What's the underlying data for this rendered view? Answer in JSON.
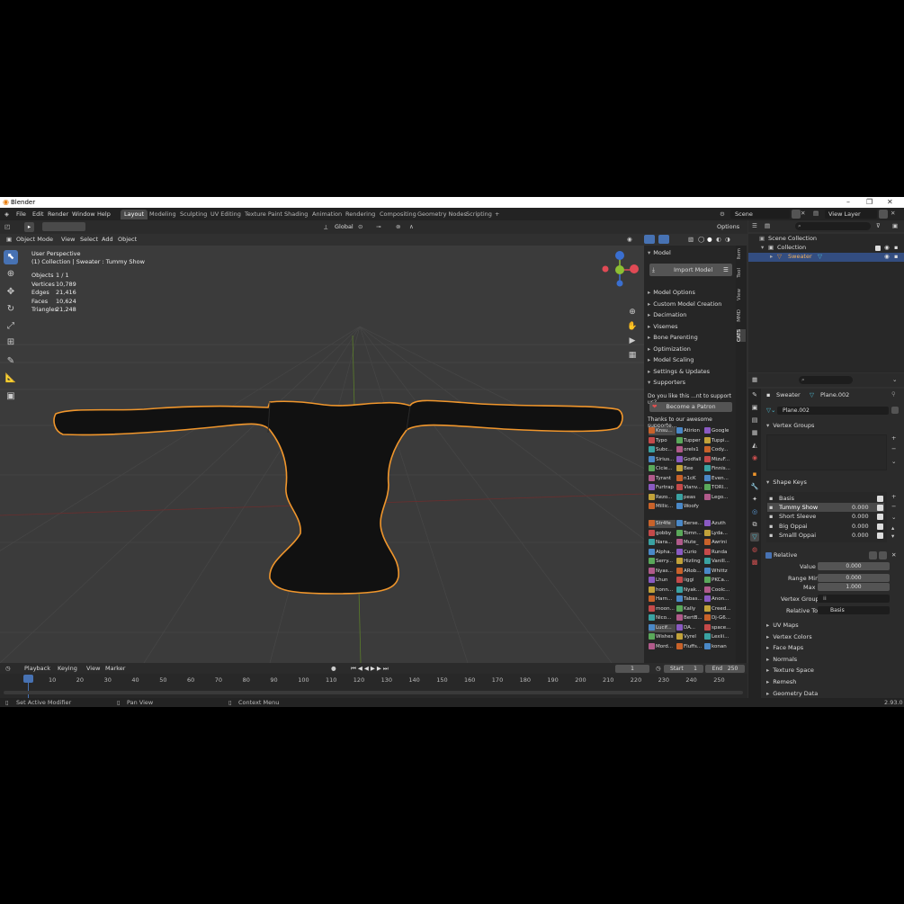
{
  "titlebar": {
    "title": "Blender",
    "min": "–",
    "max": "❐",
    "close": "✕"
  },
  "menu": [
    "File",
    "Edit",
    "Render",
    "Window",
    "Help"
  ],
  "workspaces": [
    "Layout",
    "Modeling",
    "Sculpting",
    "UV Editing",
    "Texture Paint",
    "Shading",
    "Animation",
    "Rendering",
    "Compositing",
    "Geometry Nodes",
    "Scripting"
  ],
  "active_workspace": "Layout",
  "add_tab": "+",
  "scene": "Scene",
  "view_layer": "View Layer",
  "viewport_header": {
    "mode": "Object Mode",
    "view": "View",
    "select": "Select",
    "add": "Add",
    "object": "Object",
    "transform": "Global",
    "options": "Options"
  },
  "overlay": {
    "perspective": "User Perspective",
    "collection": "(1) Collection | Sweater : Tummy Show"
  },
  "stats": [
    {
      "label": "Objects",
      "value": "1 / 1"
    },
    {
      "label": "Vertices",
      "value": "10,789"
    },
    {
      "label": "Edges",
      "value": "21,416"
    },
    {
      "label": "Faces",
      "value": "10,624"
    },
    {
      "label": "Triangles",
      "value": "21,248"
    }
  ],
  "npanel": {
    "model_header": "Model",
    "import_model": "Import Model",
    "sections": [
      "Model Options",
      "Custom Model Creation",
      "Decimation",
      "Visemes",
      "Bone Parenting",
      "Optimization",
      "Model Scaling",
      "Settings & Updates",
      "Supporters"
    ],
    "support_q": "Do you like this ...nt to support us?",
    "patron": "Become a Patron",
    "thanks": "Thanks to our awesome supporte...",
    "supporters_a": [
      "Knsu...",
      "Atirion",
      "Google",
      "Typo",
      "Tupper",
      "Tuppi...",
      "Subc...",
      "orels1",
      "Cody...",
      "Sirius...",
      "Godfall",
      "MizuF...",
      "Cicie...",
      "Bee",
      "Finnis...",
      "Tyrant",
      "n1cK",
      "Even...",
      "Furtrap",
      "Vianv...",
      "TORI...",
      "Rezo...",
      "peas",
      "Lego...",
      "Millic...",
      "Woofy"
    ],
    "supporters_b": [
      "Str4fe",
      "Berse...",
      "Azuth",
      "gobby",
      "Tomn...",
      "Lyda...",
      "Nara...",
      "Mute_",
      "Awrini",
      "Alpha...",
      "Curio",
      "Runda",
      "Serry...",
      "Hizling",
      "Vanill...",
      "Nyas...",
      "ARob...",
      "Whittz",
      "Lhun",
      "iiggi",
      "PKCa...",
      "honn...",
      "Nyak...",
      "Coolc...",
      "Harn...",
      "Tabas...",
      "Anon...",
      "moon...",
      "Kally",
      "Creed...",
      "Nico...",
      "BertB...",
      "Dj-G6...",
      "Lucif...",
      "DA...",
      "space...",
      "Wishes",
      "Vyrel",
      "Lexiii...",
      "Mord...",
      "Fluffs...",
      "konan"
    ]
  },
  "sidetabs": [
    "Item",
    "Tool",
    "View",
    "MMD",
    "CATS"
  ],
  "outliner": {
    "scene_collection": "Scene Collection",
    "collection": "Collection",
    "object": "Sweater"
  },
  "props": {
    "object": "Sweater",
    "mesh": "Plane.002",
    "mesh_field": "Plane.002",
    "vertex_groups": "Vertex Groups",
    "shape_keys": "Shape Keys",
    "keys": [
      {
        "name": "Basis",
        "value": ""
      },
      {
        "name": "Tummy Show",
        "value": "0.000"
      },
      {
        "name": "Short Sleeve",
        "value": "0.000"
      },
      {
        "name": "Big Oppai",
        "value": "0.000"
      },
      {
        "name": "Smalll Oppai",
        "value": "0.000"
      }
    ],
    "relative": "Relative",
    "value_label": "Value",
    "value": "0.000",
    "range_min_label": "Range Min",
    "range_min": "0.000",
    "max_label": "Max",
    "max": "1.000",
    "vertex_group_label": "Vertex Group",
    "relative_to_label": "Relative To",
    "relative_to": "Basis",
    "more_sections": [
      "UV Maps",
      "Vertex Colors",
      "Face Maps",
      "Normals",
      "Texture Space",
      "Remesh",
      "Geometry Data"
    ]
  },
  "timeline": {
    "playback": "Playback",
    "keying": "Keying",
    "view": "View",
    "marker": "Marker",
    "current": "1",
    "start_label": "Start",
    "start": "1",
    "end_label": "End",
    "end": "250",
    "frames": [
      "1",
      "10",
      "20",
      "30",
      "40",
      "50",
      "60",
      "70",
      "80",
      "90",
      "100",
      "110",
      "120",
      "130",
      "140",
      "150",
      "160",
      "170",
      "180",
      "190",
      "200",
      "210",
      "220",
      "230",
      "240",
      "250"
    ]
  },
  "status": {
    "left": "Set Active Modifier",
    "mid": "Pan View",
    "right": "Context Menu",
    "version": "2.93.0"
  },
  "colors": {
    "accent": "#4772b3",
    "selection_outline": "#f0962c",
    "bg": "#303030"
  }
}
